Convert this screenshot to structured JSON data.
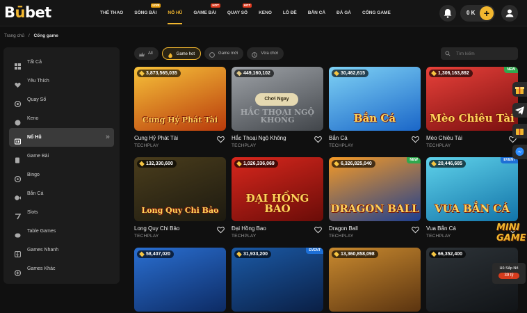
{
  "logo": {
    "part1": "B",
    "part2": "ū",
    "part3": "bet"
  },
  "nav": [
    {
      "label": "THỂ THAO",
      "tag": ""
    },
    {
      "label": "SÒNG BÀI",
      "tag": "LIVE"
    },
    {
      "label": "NỔ HŨ",
      "tag": "",
      "active": true
    },
    {
      "label": "GAME BÀI",
      "tag": "HOT"
    },
    {
      "label": "QUAY SỐ",
      "tag": "HOT"
    },
    {
      "label": "KENO",
      "tag": ""
    },
    {
      "label": "LÔ ĐỀ",
      "tag": ""
    },
    {
      "label": "BẮN CÁ",
      "tag": ""
    },
    {
      "label": "ĐÁ GÀ",
      "tag": ""
    },
    {
      "label": "CỔNG GAME",
      "tag": ""
    }
  ],
  "wallet": {
    "amount": "0 K",
    "plus": "+"
  },
  "breadcrumb": {
    "home": "Trang chủ",
    "sep": "/",
    "current": "Cổng game"
  },
  "sidebar": [
    {
      "label": "Tất Cả",
      "icon": "grid-icon"
    },
    {
      "label": "Yêu Thích",
      "icon": "heart-icon"
    },
    {
      "label": "Quay Số",
      "icon": "lottery-icon"
    },
    {
      "label": "Keno",
      "icon": "keno-icon"
    },
    {
      "label": "Nổ Hũ",
      "icon": "jackpot-icon",
      "active": true
    },
    {
      "label": "Game Bài",
      "icon": "cards-icon"
    },
    {
      "label": "Bingo",
      "icon": "bingo-icon"
    },
    {
      "label": "Bắn Cá",
      "icon": "fish-icon"
    },
    {
      "label": "Slots",
      "icon": "slots-icon"
    },
    {
      "label": "Table Games",
      "icon": "table-icon"
    },
    {
      "label": "Games Nhanh",
      "icon": "lightning-icon"
    },
    {
      "label": "Games Khác",
      "icon": "plus-circle-icon"
    }
  ],
  "filters": [
    {
      "label": "All",
      "icon": "crown-icon"
    },
    {
      "label": "Game hot",
      "icon": "fire-icon",
      "active": true
    },
    {
      "label": "Game mới",
      "icon": "new-icon"
    },
    {
      "label": "Vừa chơi",
      "icon": "clock-icon"
    }
  ],
  "search": {
    "placeholder": "Tìm kiếm"
  },
  "games": [
    {
      "name": "Cung Hỷ Phát Tài",
      "provider": "TECHPLAY",
      "jackpot": "3,873,565,035",
      "badge": "",
      "art": "Cung Hỷ Phát Tài",
      "bg": [
        "#f7c23a",
        "#b83a0b"
      ]
    },
    {
      "name": "Hắc Thoại Ngộ Không",
      "provider": "TECHPLAY",
      "jackpot": "449,160,102",
      "badge": "",
      "art": "HẮC THOẠI NGỘ KHÔNG",
      "bg": [
        "#9aa3ad",
        "#3d4650"
      ],
      "hover": true,
      "play_label": "Chơi Ngay"
    },
    {
      "name": "Bắn Cá",
      "provider": "TECHPLAY",
      "jackpot": "30,462,615",
      "badge": "",
      "art": "Bắn Cá",
      "bg": [
        "#7fd2f5",
        "#1a66c8"
      ]
    },
    {
      "name": "Mèo Chiêu Tài",
      "provider": "TECHPLAY",
      "jackpot": "1,306,163,892",
      "badge": "NEW",
      "art": "Mèo Chiêu Tài",
      "bg": [
        "#e8413a",
        "#7a0f0f"
      ]
    },
    {
      "name": "Long Quy Chi Bảo",
      "provider": "TECHPLAY",
      "jackpot": "132,330,600",
      "badge": "",
      "art": "Long Quy Chi Bảo",
      "bg": [
        "#4a3d1c",
        "#1d1a10"
      ]
    },
    {
      "name": "Đại Hồng Bao",
      "provider": "TECHPLAY",
      "jackpot": "1,026,336,069",
      "badge": "",
      "art": "ĐẠI HỒNG BAO",
      "bg": [
        "#d8271d",
        "#6a0c08"
      ]
    },
    {
      "name": "Dragon Ball",
      "provider": "TECHPLAY",
      "jackpot": "6,326,825,040",
      "badge": "NEW",
      "art": "DRAGON BALL",
      "bg": [
        "#f59a26",
        "#1e3f8f"
      ]
    },
    {
      "name": "Vua Bắn Cá",
      "provider": "TECHPLAY",
      "jackpot": "20,446,685",
      "badge": "EVENT",
      "art": "VUA BẮN CÁ",
      "bg": [
        "#5fd2ea",
        "#1273a8"
      ]
    },
    {
      "name": "",
      "provider": "",
      "jackpot": "58,407,020",
      "badge": "",
      "art": "",
      "bg": [
        "#2a6fd1",
        "#0d2b64"
      ]
    },
    {
      "name": "",
      "provider": "",
      "jackpot": "31,933,200",
      "badge": "EVENT",
      "art": "",
      "bg": [
        "#1b5aa6",
        "#0a1f45"
      ]
    },
    {
      "name": "",
      "provider": "",
      "jackpot": "13,360,858,098",
      "badge": "",
      "art": "",
      "bg": [
        "#c98a2f",
        "#5b3410"
      ]
    },
    {
      "name": "",
      "provider": "",
      "jackpot": "66,352,400",
      "badge": "",
      "art": "",
      "bg": [
        "#2d3338",
        "#111417"
      ]
    }
  ],
  "promo": {
    "logo": "MINI GAME",
    "hu_label": "Hũ Sắp Nổ",
    "hu_value": "39 tỷ"
  },
  "colors": {
    "accent": "#f2b72f",
    "background": "#101010",
    "panel": "#1c1c1c"
  }
}
